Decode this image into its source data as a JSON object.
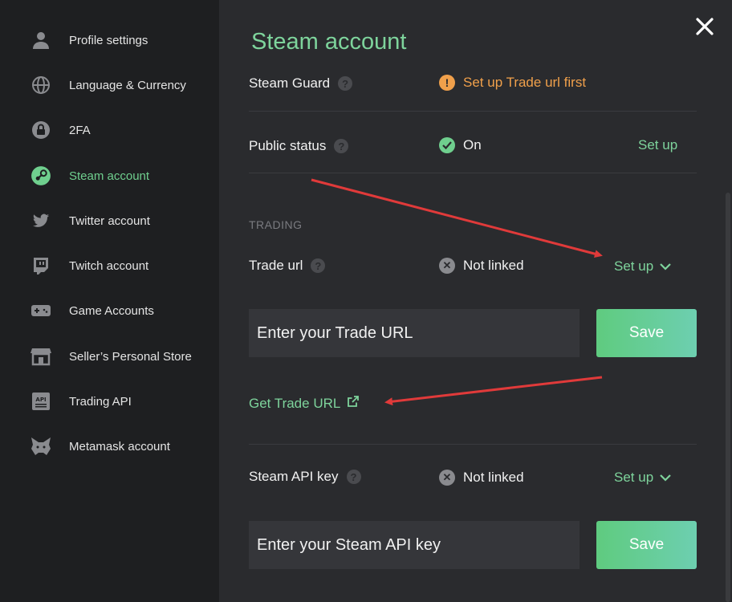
{
  "sidebar": {
    "items": [
      {
        "label": "Profile settings",
        "icon": "user-icon",
        "active": false
      },
      {
        "label": "Language & Currency",
        "icon": "globe-icon",
        "active": false
      },
      {
        "label": "2FA",
        "icon": "lock-icon",
        "active": false
      },
      {
        "label": "Steam account",
        "icon": "steam-icon",
        "active": true
      },
      {
        "label": "Twitter account",
        "icon": "twitter-icon",
        "active": false
      },
      {
        "label": "Twitch account",
        "icon": "twitch-icon",
        "active": false
      },
      {
        "label": "Game Accounts",
        "icon": "gamepad-icon",
        "active": false
      },
      {
        "label": "Seller’s Personal Store",
        "icon": "store-icon",
        "active": false
      },
      {
        "label": "Trading API",
        "icon": "api-icon",
        "active": false
      },
      {
        "label": "Metamask account",
        "icon": "fox-icon",
        "active": false
      }
    ]
  },
  "main": {
    "title": "Steam account",
    "steam_guard": {
      "label": "Steam Guard",
      "status": "Set up Trade url first",
      "status_color": "#f0a04b"
    },
    "public_status": {
      "label": "Public status",
      "status": "On",
      "action": "Set up"
    },
    "trading_section": "TRADING",
    "trade_url": {
      "label": "Trade url",
      "status": "Not linked",
      "action": "Set up",
      "placeholder": "Enter your Trade URL",
      "save_label": "Save",
      "link_label": "Get Trade URL"
    },
    "api_key": {
      "label": "Steam API key",
      "status": "Not linked",
      "action": "Set up",
      "placeholder": "Enter your Steam API key",
      "save_label": "Save"
    }
  },
  "colors": {
    "accent": "#7ed49c",
    "warning": "#f0a04b",
    "arrow": "#e03a3a",
    "background": "#2a2b2e",
    "sidebar": "#1e1f21"
  }
}
